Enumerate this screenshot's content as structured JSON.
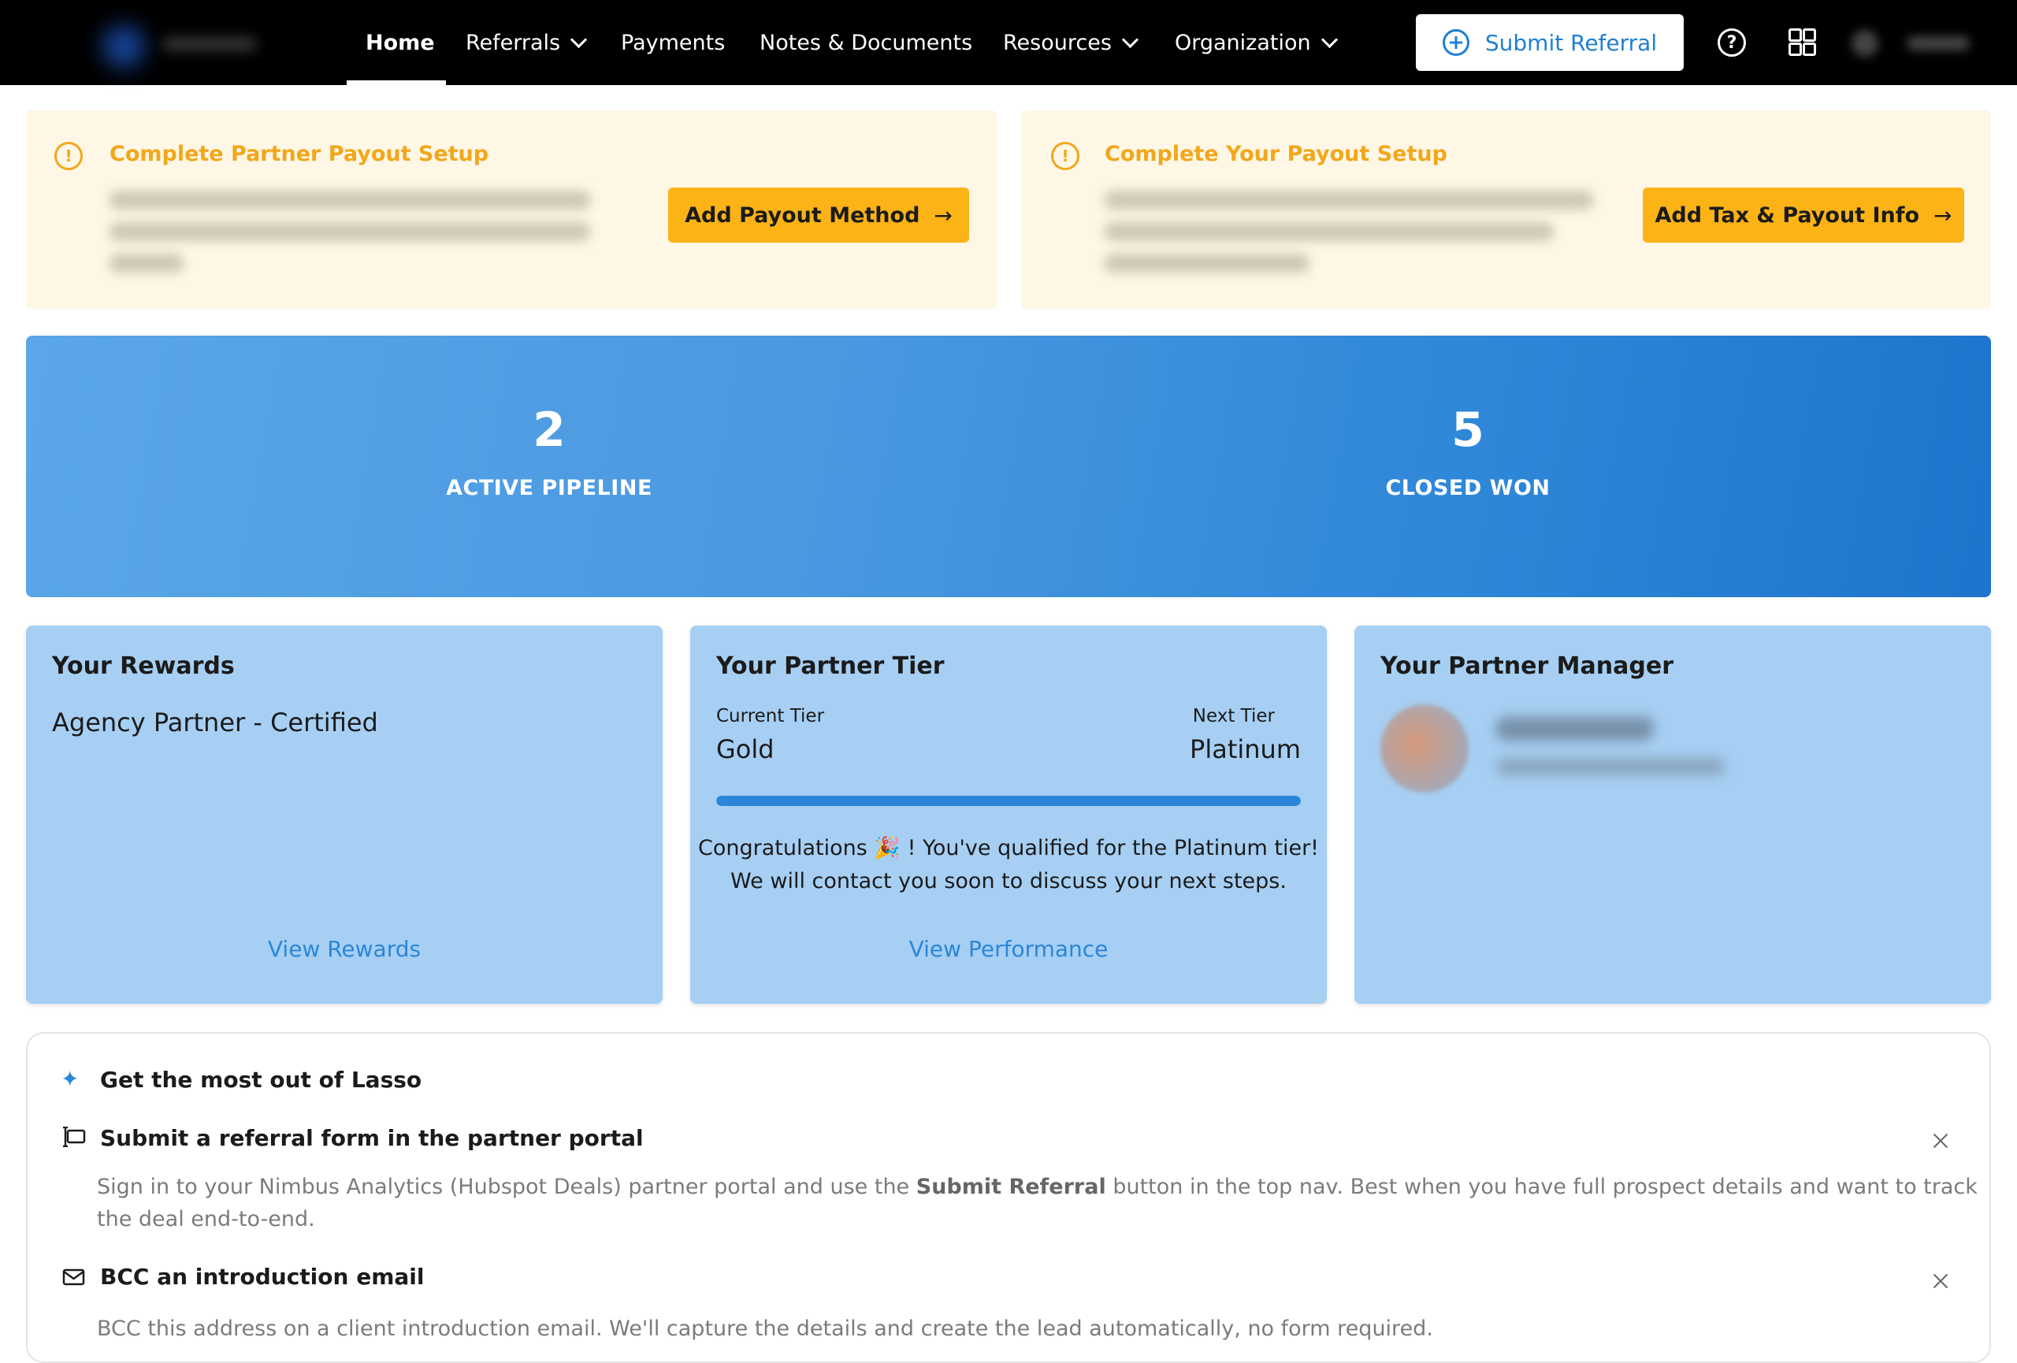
{
  "nav": {
    "items": [
      {
        "label": "Home",
        "active": true
      },
      {
        "label": "Referrals",
        "dropdown": true
      },
      {
        "label": "Payments"
      },
      {
        "label": "Notes & Documents"
      },
      {
        "label": "Resources",
        "dropdown": true
      },
      {
        "label": "Organization",
        "dropdown": true
      }
    ],
    "submit_label": "Submit Referral",
    "help_icon": "?",
    "icons": [
      "plus-circle-icon",
      "help-icon",
      "grid-icon"
    ]
  },
  "alerts": [
    {
      "title": "Complete Partner Payout Setup",
      "button": "Add Payout Method"
    },
    {
      "title": "Complete Your Payout Setup",
      "button": "Add Tax & Payout Info"
    }
  ],
  "stats": [
    {
      "value": "2",
      "label": "ACTIVE PIPELINE"
    },
    {
      "value": "5",
      "label": "CLOSED WON"
    }
  ],
  "rewards": {
    "title": "Your Rewards",
    "value": "Agency Partner - Certified",
    "link": "View Rewards"
  },
  "tier": {
    "title": "Your Partner Tier",
    "current_label": "Current Tier",
    "current": "Gold",
    "next_label": "Next Tier",
    "next": "Platinum",
    "progress": 1.0,
    "congrats_line1": "Congratulations 🎉 ! You've qualified for the Platinum tier!",
    "congrats_line2": "We will contact you soon to discuss your next steps.",
    "link": "View Performance"
  },
  "manager": {
    "title": "Your Partner Manager"
  },
  "tips": {
    "title": "Get the most out of Lasso",
    "items": [
      {
        "title": "Submit a referral form in the partner portal",
        "desc_pre": "Sign in to your Nimbus Analytics (Hubspot Deals) partner portal and use the ",
        "desc_bold": "Submit Referral",
        "desc_post": " button in the top nav. Best when you have full prospect details and want to track the deal end-to-end."
      },
      {
        "title": "BCC an introduction email",
        "desc": "BCC this address on a client introduction email. We'll capture the details and create the lead automatically, no form required."
      }
    ]
  },
  "colors": {
    "accent": "#2a86d8",
    "warning": "#fcb316",
    "warning_bg": "#fef7e6",
    "card_bg": "#a6cff3"
  }
}
